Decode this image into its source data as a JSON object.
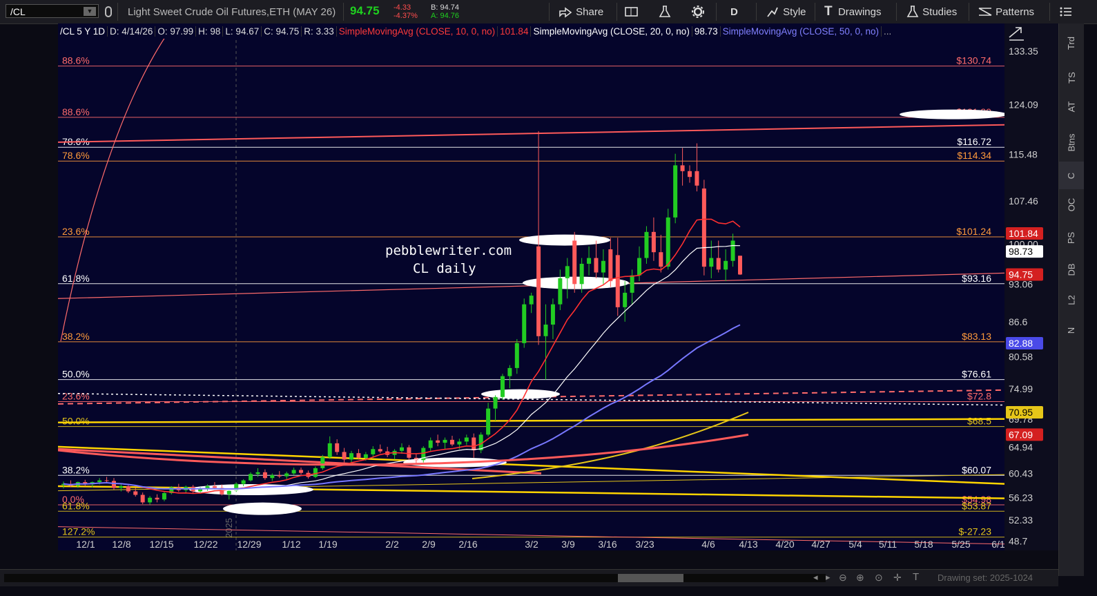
{
  "toolbar": {
    "symbol": "/CL",
    "title": "Light Sweet Crude Oil Futures,ETH (MAY 26)",
    "last": "94.75",
    "change": "-4.33",
    "change_pct": "-4.37%",
    "bid": "B: 94.74",
    "ask": "A: 94.76",
    "share": "Share",
    "timeframe": "D",
    "style": "Style",
    "drawings": "Drawings",
    "studies": "Studies",
    "patterns": "Patterns"
  },
  "study_bar": {
    "symbol_period": "/CL 5 Y 1D",
    "date": "D: 4/14/26",
    "open": "O: 97.99",
    "high": "H: 98",
    "low": "L: 94.67",
    "close": "C: 94.75",
    "range": "R: 3.33",
    "sma10_label": "SimpleMovingAvg (CLOSE, 10, 0, no)",
    "sma10_value": "101.84",
    "sma20_label": "SimpleMovingAvg (CLOSE, 20, 0, no)",
    "sma20_value": "98.73",
    "sma50_label": "SimpleMovingAvg (CLOSE, 50, 0, no)",
    "more": "..."
  },
  "watermark": {
    "line1": "pebblewriter.com",
    "line2": "CL daily"
  },
  "side_tabs": [
    "Trd",
    "TS",
    "AT",
    "Btns",
    "C",
    "OC",
    "PS",
    "DB",
    "L2",
    "N"
  ],
  "bottom": {
    "drawing_set": "Drawing set: 2025-1024"
  },
  "colors": {
    "background": "#05052b",
    "up": "#22cc22",
    "down": "#ff5a5a",
    "sma10": "#ff3030",
    "sma20": "#ffffff",
    "sma50": "#7777ff",
    "gold": "#e6c619",
    "fib_orange": "#ff9a3c",
    "fib_red": "#ff4a4a"
  },
  "chart_data": {
    "type": "candlestick",
    "price_scale": {
      "min": 47.7,
      "max": 137.5
    },
    "y_tick_labels": [
      "133.35",
      "124.09",
      "115.48",
      "107.46",
      "100.00",
      "93.06",
      "86.6",
      "80.58",
      "74.99",
      "69.78",
      "64.94",
      "60.43",
      "56.23",
      "52.33",
      "48.7"
    ],
    "x_tick_labels": [
      "12/1",
      "12/8",
      "12/15",
      "12/22",
      "12/29",
      "1/12",
      "1/19",
      "2/2",
      "2/9",
      "2/16",
      "3/2",
      "3/9",
      "3/16",
      "3/23",
      "4/6",
      "4/13",
      "4/20",
      "4/27",
      "5/4",
      "5/11",
      "5/18",
      "5/25",
      "6/1"
    ],
    "vertical_marker": "2025",
    "price_badges": [
      {
        "value": "101.84",
        "bg": "#d42020",
        "fg": "#ffffff"
      },
      {
        "value": "98.73",
        "bg": "#ffffff",
        "fg": "#000000"
      },
      {
        "value": "94.75",
        "bg": "#d42020",
        "fg": "#ffffff"
      },
      {
        "value": "82.88",
        "bg": "#4a4ae8",
        "fg": "#ffffff"
      },
      {
        "value": "70.95",
        "bg": "#e6c619",
        "fg": "#000000"
      },
      {
        "value": "67.09",
        "bg": "#d42020",
        "fg": "#ffffff"
      }
    ],
    "fib_levels": [
      {
        "pct": "88.6%",
        "price": "$130.74",
        "value": 130.74,
        "color": "#ff6b6b"
      },
      {
        "pct": "88.6%",
        "price": "$121.89",
        "value": 121.89,
        "color": "#ff6b6b"
      },
      {
        "pct": "78.6%",
        "price": "$116.72",
        "value": 116.72,
        "color": "#ffffff"
      },
      {
        "pct": "78.6%",
        "price": "$114.34",
        "value": 114.34,
        "color": "#ff9a3c"
      },
      {
        "pct": "23.6%",
        "price": "$101.24",
        "value": 101.24,
        "color": "#ff9a3c"
      },
      {
        "pct": "61.8%",
        "price": "$93.16",
        "value": 93.16,
        "color": "#ffffff"
      },
      {
        "pct": "38.2%",
        "price": "$83.13",
        "value": 83.13,
        "color": "#ff9a3c"
      },
      {
        "pct": "50.0%",
        "price": "$76.61",
        "value": 76.61,
        "color": "#ffffff"
      },
      {
        "pct": "23.6%",
        "price": "$72.8",
        "value": 72.8,
        "color": "#ff6b6b"
      },
      {
        "pct": "50.0%",
        "price": "$68.5",
        "value": 68.5,
        "color": "#e6c619"
      },
      {
        "pct": "38.2%",
        "price": "$60.07",
        "value": 60.07,
        "color": "#ffffff"
      },
      {
        "pct": "0.0%",
        "price": "$54.98",
        "value": 54.98,
        "color": "#ff6b6b"
      },
      {
        "pct": "61.8%",
        "price": "$53.87",
        "value": 53.87,
        "color": "#e6c619"
      },
      {
        "pct": "127.2%",
        "price": "$-27.23",
        "value": 49.4,
        "color": "#e6c619"
      }
    ],
    "candles": [
      [
        58.4,
        59.0,
        57.8,
        58.6
      ],
      [
        58.6,
        59.2,
        58.0,
        58.3
      ],
      [
        58.3,
        59.0,
        57.9,
        58.9
      ],
      [
        58.9,
        59.3,
        58.2,
        58.5
      ],
      [
        58.5,
        59.0,
        58.0,
        58.9
      ],
      [
        58.9,
        59.6,
        58.5,
        59.2
      ],
      [
        59.2,
        59.8,
        58.8,
        59.1
      ],
      [
        59.1,
        59.6,
        57.6,
        57.9
      ],
      [
        57.9,
        58.5,
        57.3,
        58.2
      ],
      [
        58.2,
        58.6,
        57.0,
        57.3
      ],
      [
        57.3,
        57.9,
        56.4,
        56.7
      ],
      [
        56.7,
        57.1,
        55.1,
        55.4
      ],
      [
        55.4,
        56.5,
        55.0,
        56.2
      ],
      [
        56.2,
        56.8,
        55.4,
        55.9
      ],
      [
        55.9,
        57.2,
        55.6,
        57.0
      ],
      [
        57.0,
        58.2,
        56.8,
        58.0
      ],
      [
        58.0,
        58.6,
        57.2,
        57.5
      ],
      [
        57.5,
        58.3,
        57.1,
        58.1
      ],
      [
        58.1,
        58.4,
        57.0,
        57.3
      ],
      [
        57.3,
        58.0,
        56.9,
        57.8
      ],
      [
        57.8,
        58.5,
        57.4,
        58.2
      ],
      [
        58.2,
        58.9,
        57.6,
        57.9
      ],
      [
        57.9,
        58.5,
        56.6,
        56.8
      ],
      [
        56.8,
        57.6,
        55.9,
        57.4
      ],
      [
        57.4,
        58.8,
        57.2,
        58.6
      ],
      [
        58.6,
        59.4,
        58.2,
        59.2
      ],
      [
        59.2,
        60.6,
        59.0,
        60.3
      ],
      [
        60.3,
        61.3,
        59.8,
        60.6
      ],
      [
        60.6,
        61.1,
        59.3,
        59.6
      ],
      [
        59.6,
        60.4,
        59.1,
        60.1
      ],
      [
        60.1,
        60.8,
        59.6,
        59.9
      ],
      [
        59.9,
        60.7,
        59.4,
        60.4
      ],
      [
        60.4,
        61.4,
        60.1,
        61.0
      ],
      [
        61.0,
        61.4,
        60.2,
        60.5
      ],
      [
        60.5,
        60.9,
        59.5,
        59.8
      ],
      [
        59.8,
        61.6,
        59.6,
        61.3
      ],
      [
        61.3,
        63.6,
        61.0,
        63.2
      ],
      [
        63.2,
        66.8,
        62.9,
        65.6
      ],
      [
        65.6,
        66.3,
        63.6,
        64.1
      ],
      [
        64.1,
        64.8,
        62.3,
        62.8
      ],
      [
        62.8,
        64.3,
        62.1,
        63.9
      ],
      [
        63.9,
        64.6,
        62.8,
        63.1
      ],
      [
        63.1,
        64.1,
        62.6,
        63.7
      ],
      [
        63.7,
        65.1,
        63.1,
        64.6
      ],
      [
        64.6,
        65.4,
        63.9,
        64.2
      ],
      [
        64.2,
        65.0,
        63.2,
        63.6
      ],
      [
        63.6,
        64.6,
        62.8,
        64.3
      ],
      [
        64.3,
        65.6,
        63.8,
        64.9
      ],
      [
        64.9,
        65.3,
        62.6,
        63.1
      ],
      [
        63.1,
        63.8,
        62.1,
        62.7
      ],
      [
        62.7,
        65.1,
        62.3,
        64.8
      ],
      [
        64.8,
        66.6,
        64.1,
        66.1
      ],
      [
        66.1,
        67.1,
        65.1,
        65.7
      ],
      [
        65.7,
        66.6,
        64.6,
        66.2
      ],
      [
        66.2,
        66.9,
        65.1,
        65.4
      ],
      [
        65.4,
        66.4,
        64.6,
        65.9
      ],
      [
        65.9,
        67.1,
        65.3,
        66.6
      ],
      [
        66.6,
        67.3,
        63.1,
        64.4
      ],
      [
        64.4,
        67.5,
        63.9,
        67.1
      ],
      [
        67.1,
        72.6,
        66.8,
        71.6
      ],
      [
        71.6,
        73.9,
        69.5,
        73.6
      ],
      [
        73.6,
        77.6,
        73.1,
        77.2
      ],
      [
        77.2,
        79.1,
        75.1,
        78.6
      ],
      [
        78.6,
        83.6,
        77.6,
        82.9
      ],
      [
        82.9,
        90.6,
        82.1,
        89.6
      ],
      [
        89.6,
        91.6,
        88.1,
        91.1
      ],
      [
        99.6,
        119.5,
        82.6,
        84.1
      ],
      [
        84.1,
        89.6,
        76.6,
        86.1
      ],
      [
        86.1,
        90.6,
        83.6,
        89.6
      ],
      [
        89.6,
        95.6,
        88.6,
        94.1
      ],
      [
        94.1,
        97.6,
        90.6,
        96.2
      ],
      [
        100.6,
        102.1,
        91.6,
        93.1
      ],
      [
        93.1,
        97.6,
        91.6,
        96.6
      ],
      [
        96.6,
        99.6,
        94.6,
        97.6
      ],
      [
        97.6,
        100.6,
        94.1,
        95.1
      ],
      [
        95.1,
        99.1,
        93.1,
        97.1
      ],
      [
        99.1,
        101.1,
        92.6,
        93.6
      ],
      [
        98.1,
        101.1,
        87.6,
        89.1
      ],
      [
        89.1,
        93.6,
        86.6,
        91.6
      ],
      [
        91.6,
        95.6,
        89.6,
        94.6
      ],
      [
        94.6,
        99.6,
        93.6,
        97.6
      ],
      [
        97.6,
        103.1,
        96.6,
        102.1
      ],
      [
        102.1,
        104.6,
        97.1,
        98.6
      ],
      [
        98.6,
        101.6,
        95.1,
        96.1
      ],
      [
        96.1,
        106.1,
        95.6,
        104.6
      ],
      [
        104.6,
        115.6,
        103.6,
        113.6
      ],
      [
        113.6,
        116.6,
        110.1,
        112.6
      ],
      [
        112.6,
        113.6,
        110.6,
        111.6
      ],
      [
        112.6,
        117.4,
        109.1,
        110.1
      ],
      [
        109.6,
        111.1,
        94.6,
        96.1
      ],
      [
        96.1,
        100.6,
        94.1,
        97.6
      ],
      [
        97.6,
        100.6,
        95.1,
        95.6
      ],
      [
        95.6,
        99.1,
        93.6,
        97.1
      ],
      [
        97.1,
        101.8,
        96.1,
        100.6
      ],
      [
        97.99,
        98.0,
        94.67,
        94.75
      ]
    ],
    "moving_averages": {
      "sma10_last": 101.84,
      "sma20_last": 98.73,
      "sma50_last": 82.88
    }
  }
}
